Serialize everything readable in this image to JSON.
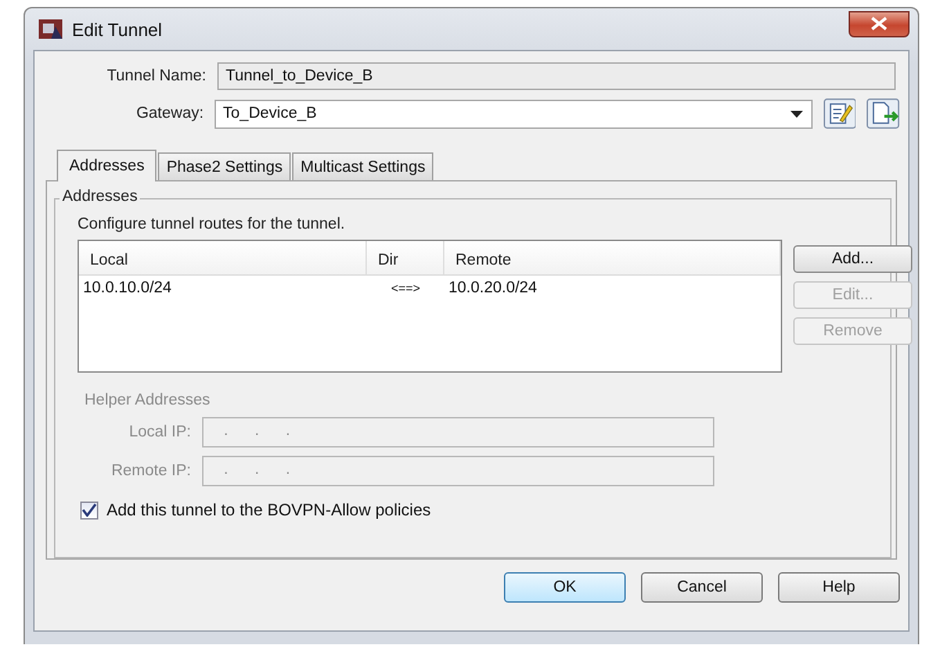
{
  "window": {
    "title": "Edit Tunnel"
  },
  "tunnel_name": {
    "label": "Tunnel Name:",
    "value": "Tunnel_to_Device_B"
  },
  "gateway": {
    "label": "Gateway:",
    "value": "To_Device_B"
  },
  "tabs": [
    {
      "label": "Addresses",
      "selected": true
    },
    {
      "label": "Phase2 Settings",
      "selected": false
    },
    {
      "label": "Multicast Settings",
      "selected": false
    }
  ],
  "addresses": {
    "title": "Addresses",
    "description": "Configure tunnel routes for the tunnel.",
    "table": {
      "columns": [
        "Local",
        "Dir",
        "Remote"
      ],
      "rows": [
        [
          "10.0.10.0/24",
          "<==>",
          "10.0.20.0/24"
        ]
      ]
    },
    "buttons": [
      {
        "label": "Add...",
        "disabled": false
      },
      {
        "label": "Edit...",
        "disabled": true
      },
      {
        "label": "Remove",
        "disabled": true
      }
    ],
    "helper": {
      "title": "Helper Addresses",
      "disabled": true,
      "fields": [
        {
          "label": "Local IP:",
          "value": "   .      .      ."
        },
        {
          "label": "Remote IP:",
          "value": "   .      .      ."
        }
      ]
    },
    "allow_policy": {
      "label": "Add this tunnel to the BOVPN-Allow policies",
      "checked": true
    }
  },
  "buttons": [
    {
      "label": "OK",
      "default": true
    },
    {
      "label": "Cancel",
      "default": false
    },
    {
      "label": "Help",
      "default": false
    }
  ]
}
